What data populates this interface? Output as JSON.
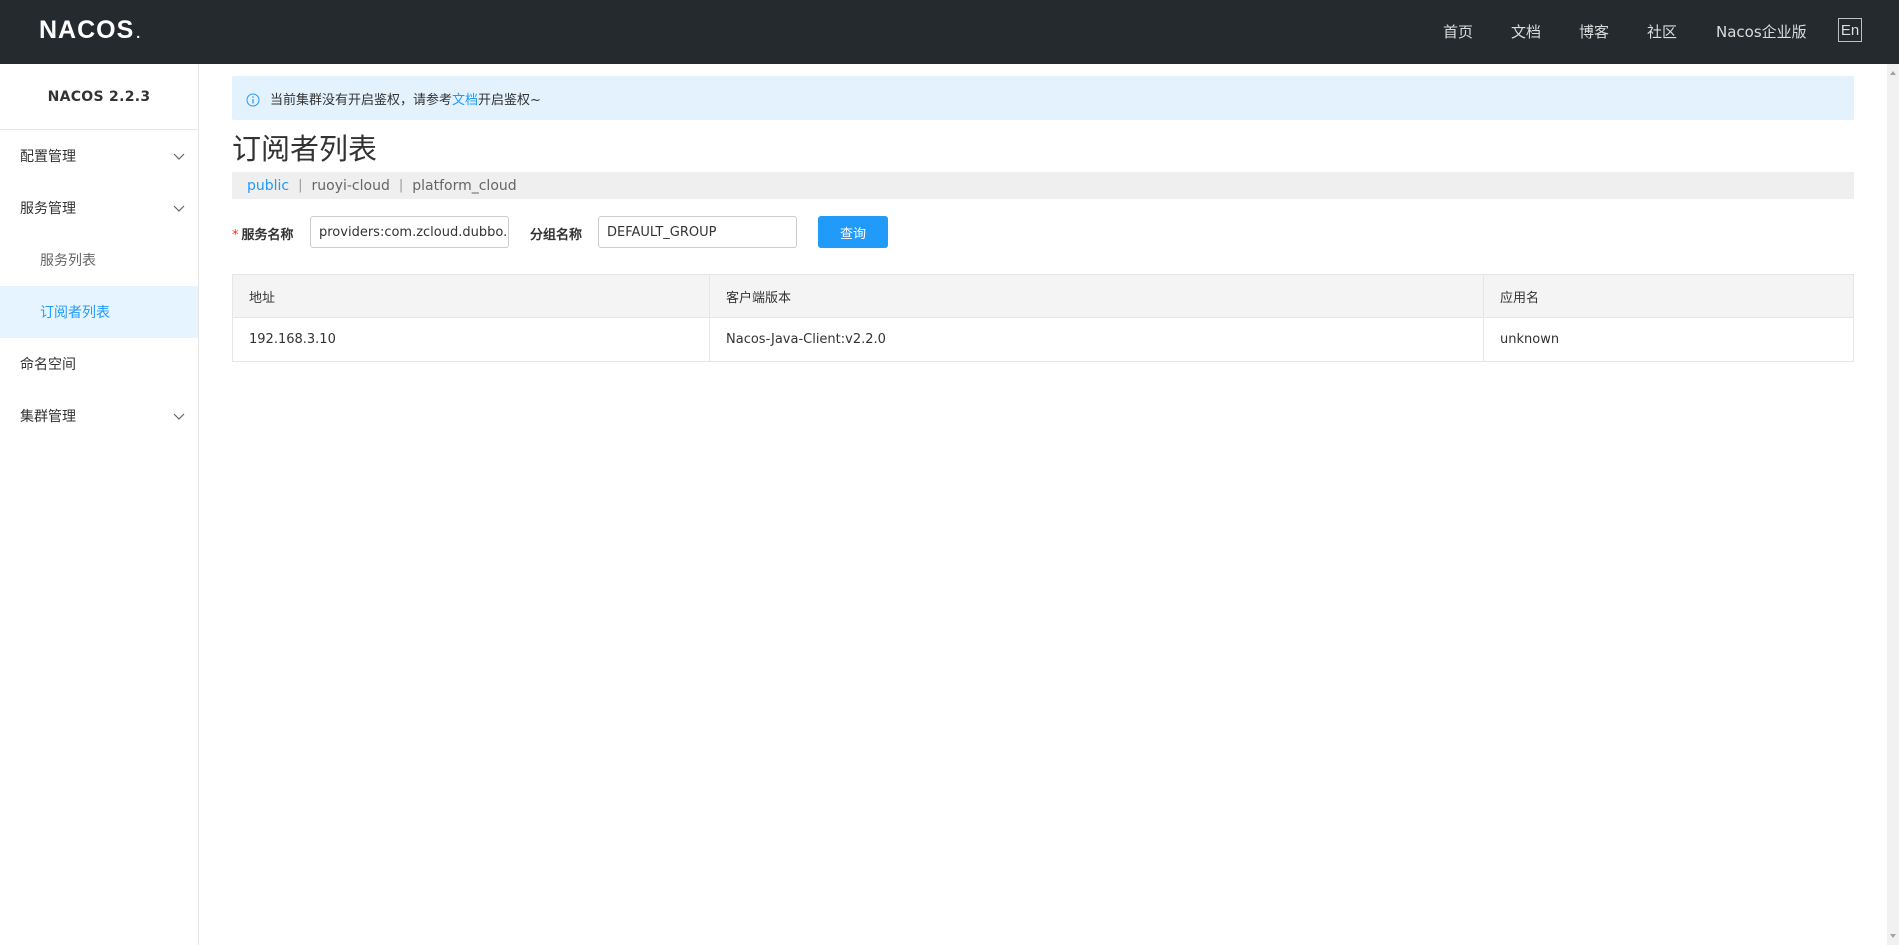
{
  "header": {
    "logo_text": "NACOS",
    "logo_dot": ".",
    "nav": [
      "首页",
      "文档",
      "博客",
      "社区",
      "Nacos企业版"
    ],
    "lang_label": "En"
  },
  "sidebar": {
    "version": "NACOS 2.2.3",
    "items": [
      {
        "label": "配置管理",
        "type": "group"
      },
      {
        "label": "服务管理",
        "type": "group"
      },
      {
        "label": "服务列表",
        "type": "sub"
      },
      {
        "label": "订阅者列表",
        "type": "sub",
        "active": true
      },
      {
        "label": "命名空间",
        "type": "item"
      },
      {
        "label": "集群管理",
        "type": "group"
      }
    ]
  },
  "alert": {
    "prefix": "当前集群没有开启鉴权，请参考",
    "link": "文档",
    "suffix": "开启鉴权~"
  },
  "page": {
    "title": "订阅者列表"
  },
  "namespaces": [
    {
      "label": "public",
      "active": true
    },
    {
      "label": "ruoyi-cloud",
      "active": false
    },
    {
      "label": "platform_cloud",
      "active": false
    }
  ],
  "namespace_separator": "|",
  "form": {
    "required_mark": "*",
    "service_label": "服务名称",
    "service_value": "providers:com.zcloud.dubbo.s",
    "group_label": "分组名称",
    "group_value": "DEFAULT_GROUP",
    "query_button": "查询"
  },
  "table": {
    "columns": [
      "地址",
      "客户端版本",
      "应用名"
    ],
    "rows": [
      [
        "192.168.3.10",
        "Nacos-Java-Client:v2.2.0",
        "unknown"
      ]
    ]
  },
  "colors": {
    "topbar": "#252a2f",
    "accent": "#209bfa",
    "alert_bg": "#e3f2fd",
    "active_menu_bg": "#e6f4ff"
  }
}
